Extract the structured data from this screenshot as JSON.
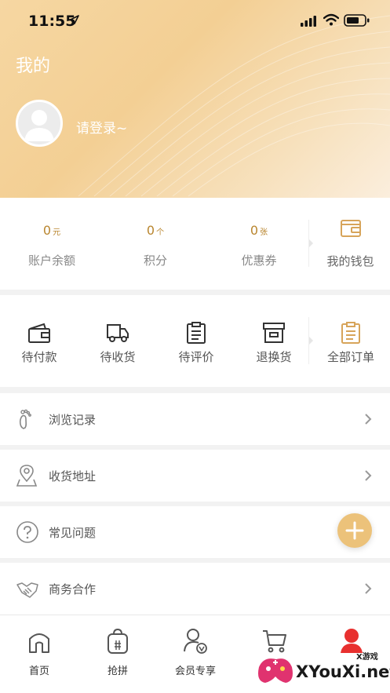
{
  "status": {
    "time": "11:55"
  },
  "header": {
    "title": "我的",
    "login_prompt": "请登录~"
  },
  "assets": [
    {
      "value": "0",
      "unit": "元",
      "label": "账户余额"
    },
    {
      "value": "0",
      "unit": "个",
      "label": "积分"
    },
    {
      "value": "0",
      "unit": "张",
      "label": "优惠券"
    }
  ],
  "wallet": {
    "label": "我的钱包"
  },
  "orders": [
    {
      "label": "待付款",
      "icon": "wallet-icon"
    },
    {
      "label": "待收货",
      "icon": "truck-icon"
    },
    {
      "label": "待评价",
      "icon": "clipboard-icon"
    },
    {
      "label": "退换货",
      "icon": "box-icon"
    },
    {
      "label": "全部订单",
      "icon": "orders-icon"
    }
  ],
  "menu": [
    {
      "label": "浏览记录",
      "icon": "footprint-icon"
    },
    {
      "label": "收货地址",
      "icon": "location-icon"
    },
    {
      "label": "常见问题",
      "icon": "question-icon"
    },
    {
      "label": "商务合作",
      "icon": "handshake-icon"
    }
  ],
  "tabs": [
    {
      "label": "首页",
      "icon": "home-icon"
    },
    {
      "label": "抢拼",
      "icon": "bag-icon"
    },
    {
      "label": "会员专享",
      "icon": "member-icon"
    },
    {
      "label": "",
      "icon": "cart-icon"
    },
    {
      "label": "",
      "icon": "profile-icon"
    }
  ],
  "watermark": {
    "text": "XYouXi.net",
    "small": "X游戏"
  },
  "colors": {
    "accent": "#b9862f",
    "header": "#f3cf94",
    "fab": "#ecc27a"
  }
}
